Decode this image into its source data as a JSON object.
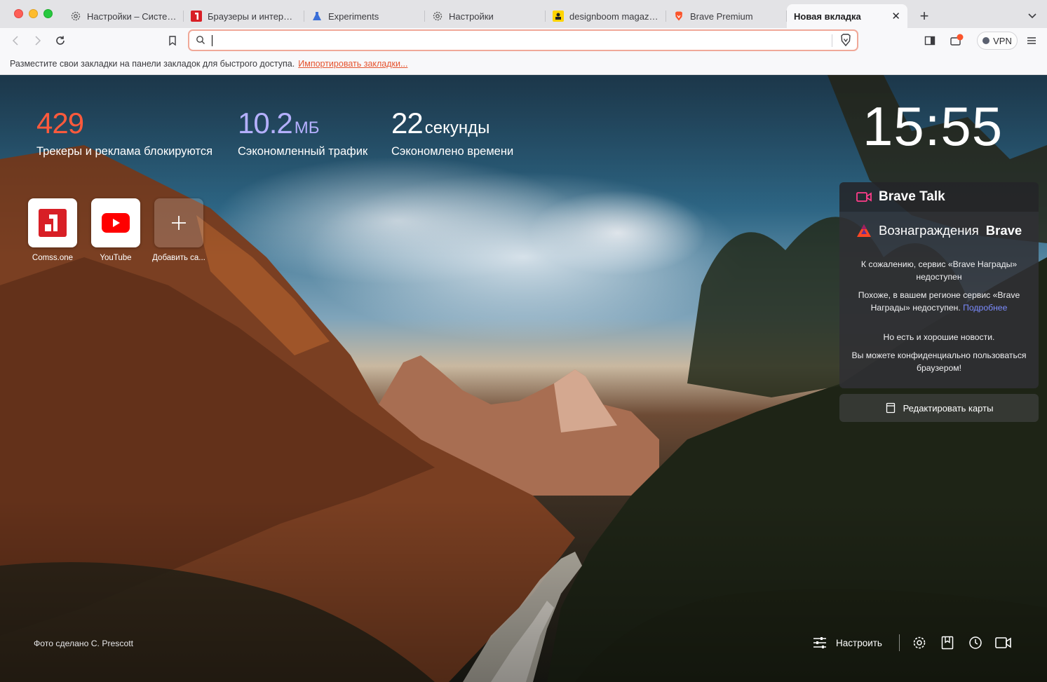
{
  "window": {
    "tabs": [
      {
        "title": "Настройки – Система",
        "icon": "gear-icon"
      },
      {
        "title": "Браузеры и интернет…",
        "icon": "comss-icon"
      },
      {
        "title": "Experiments",
        "icon": "flask-icon"
      },
      {
        "title": "Настройки",
        "icon": "gear-icon"
      },
      {
        "title": "designboom magazine",
        "icon": "designboom-icon"
      },
      {
        "title": "Brave Premium",
        "icon": "brave-lion-icon"
      },
      {
        "title": "Новая вкладка",
        "icon": "",
        "active": true
      }
    ],
    "new_tab_label": "+"
  },
  "toolbar": {
    "address_value": "",
    "vpn_label": "VPN"
  },
  "bookmarks_bar": {
    "hint": "Разместите свои закладки на панели закладок для быстрого доступа.",
    "import_link": "Импортировать закладки..."
  },
  "stats": {
    "trackers": {
      "value": "429",
      "unit": "",
      "label": "Трекеры и реклама блокируются"
    },
    "bandwidth": {
      "value": "10.2",
      "unit": "МБ",
      "label": "Сэкономленный трафик"
    },
    "time": {
      "value": "22",
      "unit": "секунды",
      "label": "Сэкономлено времени"
    }
  },
  "clock": "15:55",
  "top_sites": [
    {
      "name": "Comss.one",
      "icon": "comss-icon"
    },
    {
      "name": "YouTube",
      "icon": "youtube-icon"
    },
    {
      "name": "Добавить са...",
      "icon": "plus-icon"
    }
  ],
  "cards": {
    "talk_title": "Brave Talk",
    "rewards_title": "Вознаграждения",
    "rewards_brand": "Brave",
    "unavailable_text": "К сожалению, сервис «Brave Награды» недоступен",
    "region_text": "Похоже, в вашем регионе сервис «Brave Награды» недоступен.",
    "more_link": "Подробнее",
    "good_news": "Но есть и хорошие новости.",
    "private_text": "Вы можете конфиденциально пользоваться браузером!",
    "edit_cards": "Редактировать карты"
  },
  "photo_credit": "Фото сделано C. Prescott",
  "bottom_bar": {
    "customize_label": "Настроить"
  },
  "colors": {
    "trackers": "#ff5a3c",
    "bandwidth": "#b5b0ff",
    "link": "#e5532e",
    "rewards_link": "#7c8cff"
  }
}
